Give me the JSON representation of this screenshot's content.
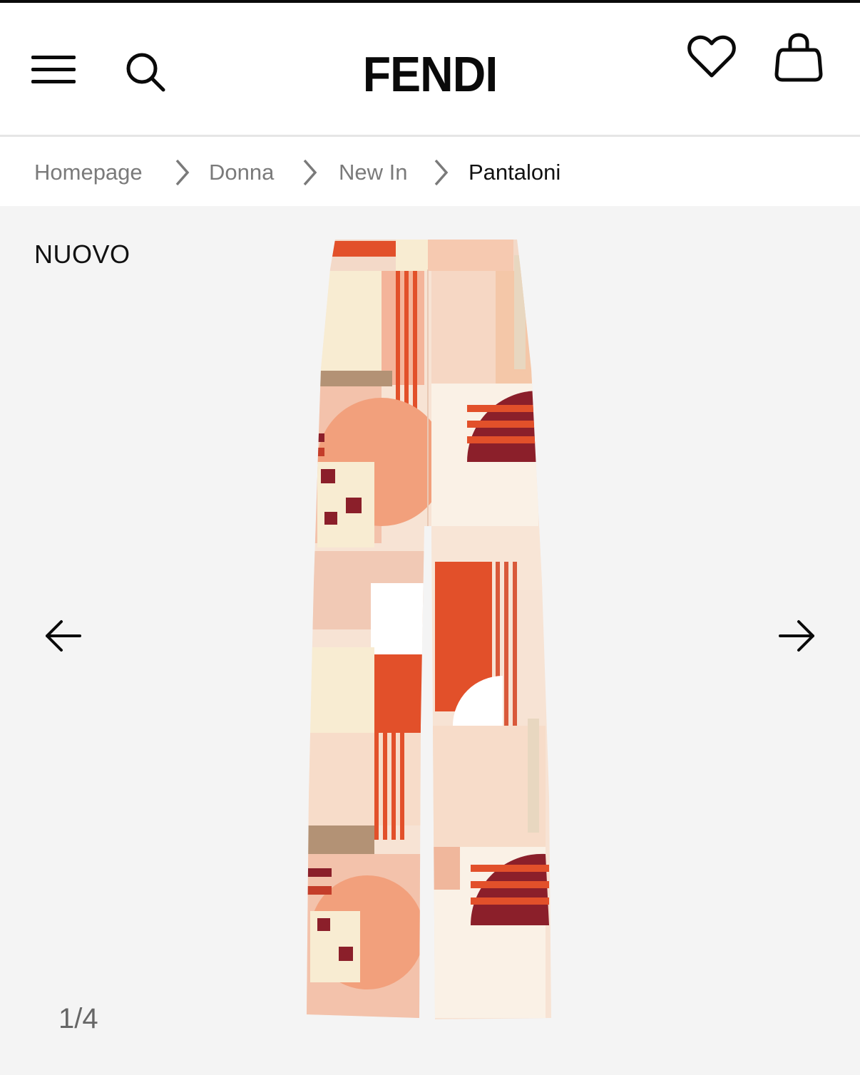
{
  "header": {
    "brand": "FENDI",
    "menu_icon": "hamburger-menu-icon",
    "search_icon": "search-icon",
    "wishlist_icon": "heart-icon",
    "bag_icon": "shopping-bag-icon"
  },
  "breadcrumb": {
    "items": [
      {
        "label": "Homepage"
      },
      {
        "label": "Donna"
      },
      {
        "label": "New In"
      },
      {
        "label": "Pantaloni"
      }
    ],
    "separator_icon": "chevron-right-icon"
  },
  "gallery": {
    "badge": "NUOVO",
    "prev_icon": "arrow-left-icon",
    "next_icon": "arrow-right-icon",
    "counter": "1/4",
    "current_image": 1,
    "total_images": 4,
    "product_image": "printed-wide-leg-trousers"
  },
  "colors": {
    "background": "#f4f4f4",
    "text": "#111111",
    "muted": "#7a7a7a",
    "print_red": "#e2502a",
    "print_peach": "#f6c9b0",
    "print_burgundy": "#8b1f2a",
    "print_cream": "#f8ecd2"
  }
}
